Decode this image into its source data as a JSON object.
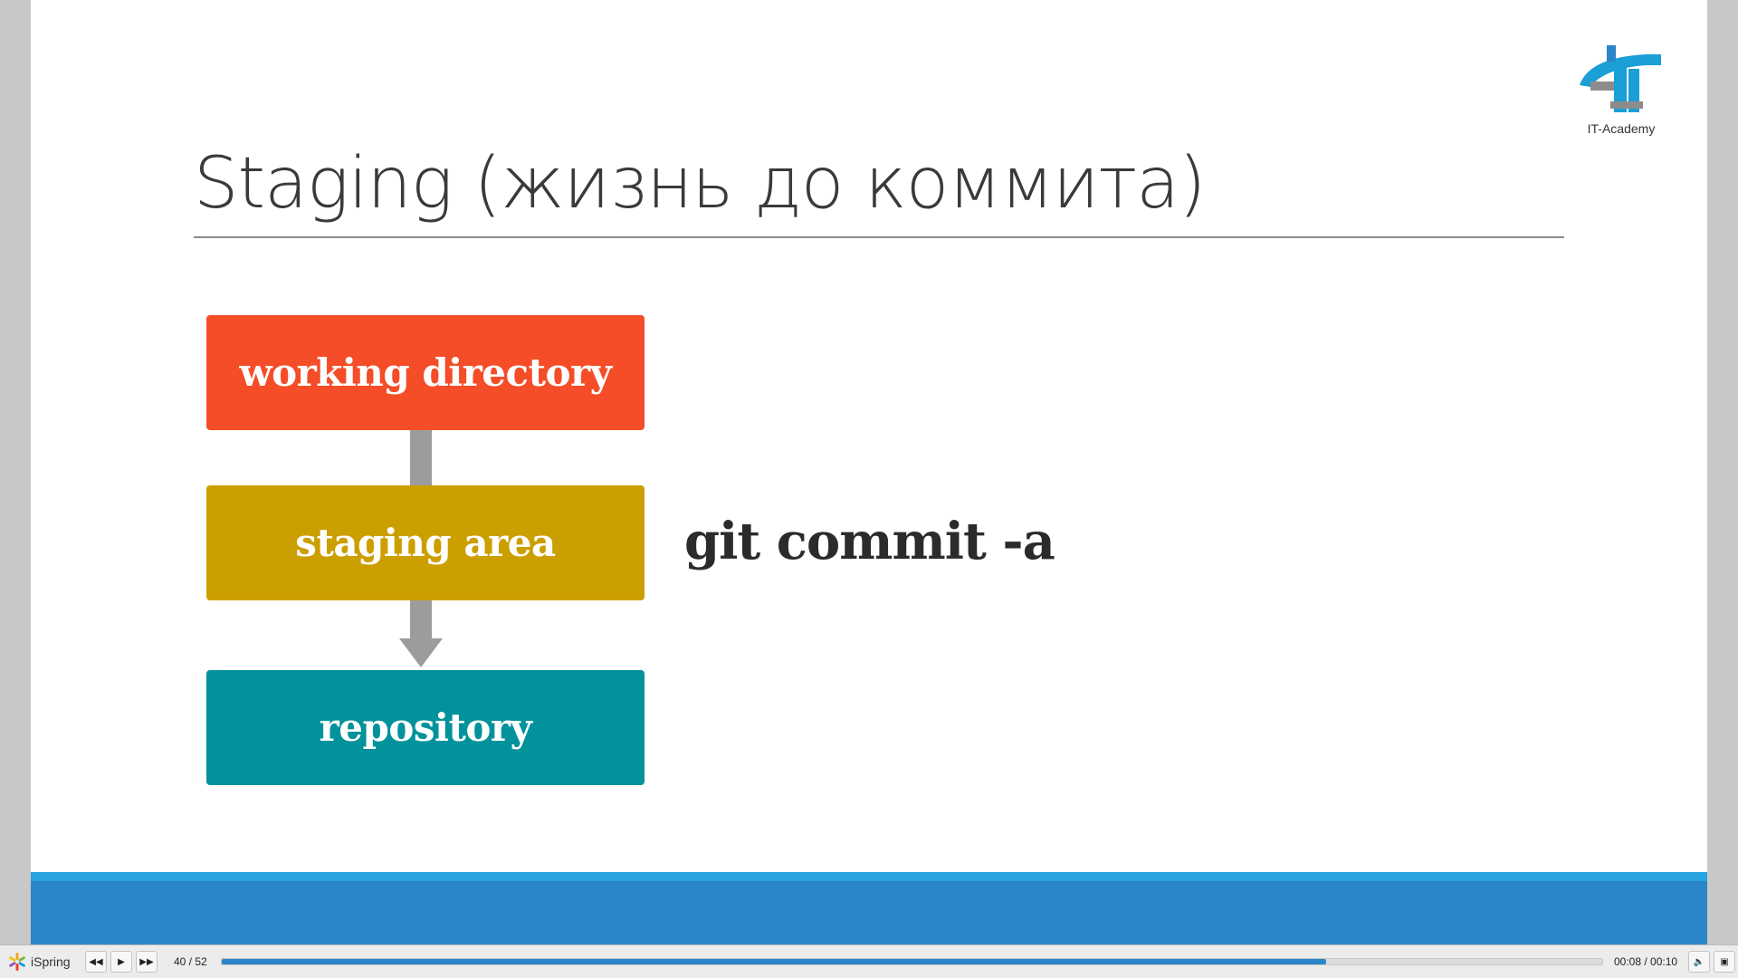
{
  "slide": {
    "title": "Staging (жизнь до коммита)",
    "logo_text": "IT-Academy",
    "diagram": {
      "boxes": [
        "working directory",
        "staging area",
        "repository"
      ],
      "command": "git commit -a"
    },
    "colors": {
      "working_directory": "#f44d27",
      "staging_area": "#cc9f00",
      "repository": "#01929b",
      "accent_stripe": "#29a3e0",
      "footer_band": "#2a85c9"
    }
  },
  "player": {
    "brand": "iSpring",
    "slide_counter": "40 / 52",
    "time": "00:08 / 00:10",
    "progress_percent": 80,
    "controls": [
      "previous-icon",
      "play-icon",
      "next-icon",
      "volume-icon",
      "fullscreen-icon"
    ]
  }
}
